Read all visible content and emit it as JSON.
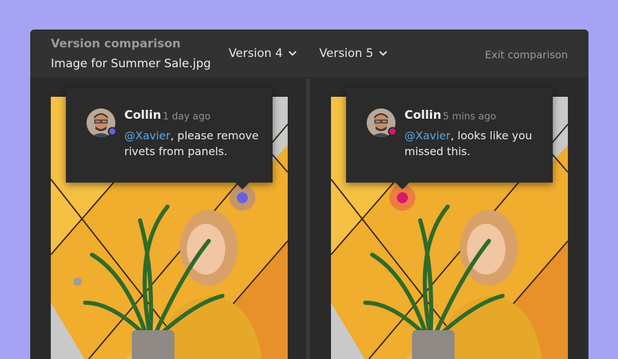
{
  "header": {
    "section_title": "Version comparison",
    "file_name": "Image for Summer Sale.jpg",
    "left_version": "Version 4",
    "right_version": "Version 5",
    "exit_label": "Exit comparison"
  },
  "left_comment": {
    "author": "Collin",
    "time": "1 day ago",
    "mention": "@Xavier",
    "message": ", please remove rivets from panels.",
    "status_color": "#6461e6"
  },
  "right_comment": {
    "author": "Collin",
    "time": "5 mins ago",
    "mention": "@Xavier",
    "message": ", looks like you missed this.",
    "status_color": "#e0156e"
  },
  "colors": {
    "background": "#a6a3f5",
    "window": "#2e2e2e",
    "mention": "#5aa6e8",
    "pin_blue": "#6461e6",
    "pin_pink": "#e0156e"
  },
  "icons": [
    "chevron-down-icon",
    "avatar-image",
    "comment-pin-icon"
  ]
}
